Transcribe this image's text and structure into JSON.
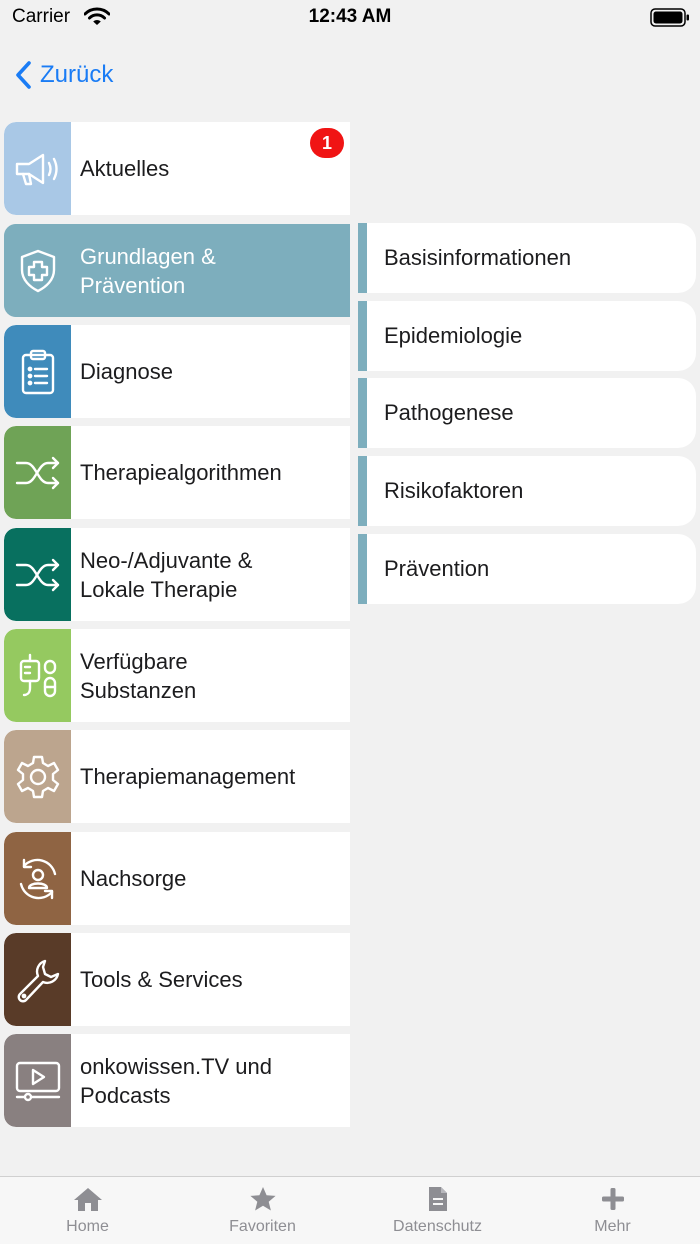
{
  "status_bar": {
    "carrier": "Carrier",
    "time": "12:43 AM"
  },
  "nav": {
    "back_label": "Zurück"
  },
  "menu": {
    "items": [
      {
        "label": "Aktuelles",
        "icon": "megaphone-icon",
        "color": "#a9c8e6",
        "badge": "1"
      },
      {
        "label": "Grundlagen &\nPrävention",
        "icon": "shield-plus-icon",
        "color": "#7daebd",
        "active": true
      },
      {
        "label": "Diagnose",
        "icon": "clipboard-list-icon",
        "color": "#3f8bbb"
      },
      {
        "label": "Therapiealgorithmen",
        "icon": "shuffle-icon",
        "color": "#6fa356"
      },
      {
        "label": "Neo-/Adjuvante &\nLokale Therapie",
        "icon": "shuffle-icon",
        "color": "#08705f"
      },
      {
        "label": "Verfügbare\nSubstanzen",
        "icon": "iv-drip-pill-icon",
        "color": "#95c960"
      },
      {
        "label": "Therapiemanagement",
        "icon": "gear-icon",
        "color": "#bca58e"
      },
      {
        "label": "Nachsorge",
        "icon": "person-cycle-icon",
        "color": "#8f6443"
      },
      {
        "label": "Tools & Services",
        "icon": "wrench-icon",
        "color": "#593b28"
      },
      {
        "label": "onkowissen.TV und\nPodcasts",
        "icon": "video-player-icon",
        "color": "#898080"
      }
    ]
  },
  "submenu": {
    "accent": "#7daebd",
    "items": [
      "Basisinformationen",
      "Epidemiologie",
      "Pathogenese",
      "Risikofaktoren",
      "Prävention"
    ]
  },
  "tab_bar": {
    "tabs": [
      {
        "label": "Home",
        "icon": "home-icon"
      },
      {
        "label": "Favoriten",
        "icon": "star-icon"
      },
      {
        "label": "Datenschutz",
        "icon": "document-icon"
      },
      {
        "label": "Mehr",
        "icon": "plus-icon"
      }
    ]
  }
}
